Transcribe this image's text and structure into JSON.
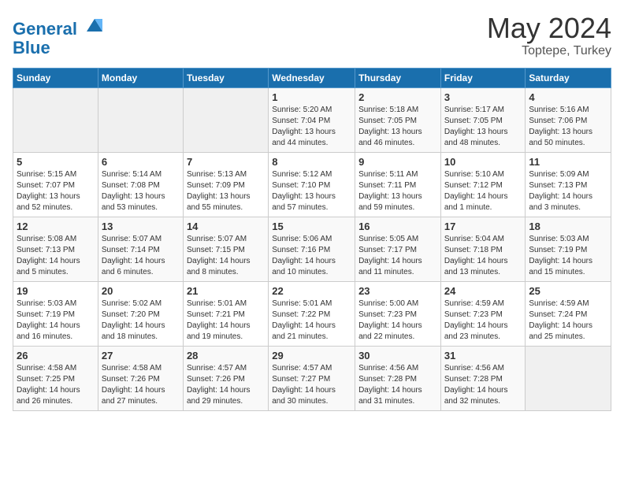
{
  "logo": {
    "line1": "General",
    "line2": "Blue"
  },
  "title": "May 2024",
  "location": "Toptepe, Turkey",
  "days_header": [
    "Sunday",
    "Monday",
    "Tuesday",
    "Wednesday",
    "Thursday",
    "Friday",
    "Saturday"
  ],
  "weeks": [
    [
      {
        "day": "",
        "info": ""
      },
      {
        "day": "",
        "info": ""
      },
      {
        "day": "",
        "info": ""
      },
      {
        "day": "1",
        "info": "Sunrise: 5:20 AM\nSunset: 7:04 PM\nDaylight: 13 hours\nand 44 minutes."
      },
      {
        "day": "2",
        "info": "Sunrise: 5:18 AM\nSunset: 7:05 PM\nDaylight: 13 hours\nand 46 minutes."
      },
      {
        "day": "3",
        "info": "Sunrise: 5:17 AM\nSunset: 7:05 PM\nDaylight: 13 hours\nand 48 minutes."
      },
      {
        "day": "4",
        "info": "Sunrise: 5:16 AM\nSunset: 7:06 PM\nDaylight: 13 hours\nand 50 minutes."
      }
    ],
    [
      {
        "day": "5",
        "info": "Sunrise: 5:15 AM\nSunset: 7:07 PM\nDaylight: 13 hours\nand 52 minutes."
      },
      {
        "day": "6",
        "info": "Sunrise: 5:14 AM\nSunset: 7:08 PM\nDaylight: 13 hours\nand 53 minutes."
      },
      {
        "day": "7",
        "info": "Sunrise: 5:13 AM\nSunset: 7:09 PM\nDaylight: 13 hours\nand 55 minutes."
      },
      {
        "day": "8",
        "info": "Sunrise: 5:12 AM\nSunset: 7:10 PM\nDaylight: 13 hours\nand 57 minutes."
      },
      {
        "day": "9",
        "info": "Sunrise: 5:11 AM\nSunset: 7:11 PM\nDaylight: 13 hours\nand 59 minutes."
      },
      {
        "day": "10",
        "info": "Sunrise: 5:10 AM\nSunset: 7:12 PM\nDaylight: 14 hours\nand 1 minute."
      },
      {
        "day": "11",
        "info": "Sunrise: 5:09 AM\nSunset: 7:13 PM\nDaylight: 14 hours\nand 3 minutes."
      }
    ],
    [
      {
        "day": "12",
        "info": "Sunrise: 5:08 AM\nSunset: 7:13 PM\nDaylight: 14 hours\nand 5 minutes."
      },
      {
        "day": "13",
        "info": "Sunrise: 5:07 AM\nSunset: 7:14 PM\nDaylight: 14 hours\nand 6 minutes."
      },
      {
        "day": "14",
        "info": "Sunrise: 5:07 AM\nSunset: 7:15 PM\nDaylight: 14 hours\nand 8 minutes."
      },
      {
        "day": "15",
        "info": "Sunrise: 5:06 AM\nSunset: 7:16 PM\nDaylight: 14 hours\nand 10 minutes."
      },
      {
        "day": "16",
        "info": "Sunrise: 5:05 AM\nSunset: 7:17 PM\nDaylight: 14 hours\nand 11 minutes."
      },
      {
        "day": "17",
        "info": "Sunrise: 5:04 AM\nSunset: 7:18 PM\nDaylight: 14 hours\nand 13 minutes."
      },
      {
        "day": "18",
        "info": "Sunrise: 5:03 AM\nSunset: 7:19 PM\nDaylight: 14 hours\nand 15 minutes."
      }
    ],
    [
      {
        "day": "19",
        "info": "Sunrise: 5:03 AM\nSunset: 7:19 PM\nDaylight: 14 hours\nand 16 minutes."
      },
      {
        "day": "20",
        "info": "Sunrise: 5:02 AM\nSunset: 7:20 PM\nDaylight: 14 hours\nand 18 minutes."
      },
      {
        "day": "21",
        "info": "Sunrise: 5:01 AM\nSunset: 7:21 PM\nDaylight: 14 hours\nand 19 minutes."
      },
      {
        "day": "22",
        "info": "Sunrise: 5:01 AM\nSunset: 7:22 PM\nDaylight: 14 hours\nand 21 minutes."
      },
      {
        "day": "23",
        "info": "Sunrise: 5:00 AM\nSunset: 7:23 PM\nDaylight: 14 hours\nand 22 minutes."
      },
      {
        "day": "24",
        "info": "Sunrise: 4:59 AM\nSunset: 7:23 PM\nDaylight: 14 hours\nand 23 minutes."
      },
      {
        "day": "25",
        "info": "Sunrise: 4:59 AM\nSunset: 7:24 PM\nDaylight: 14 hours\nand 25 minutes."
      }
    ],
    [
      {
        "day": "26",
        "info": "Sunrise: 4:58 AM\nSunset: 7:25 PM\nDaylight: 14 hours\nand 26 minutes."
      },
      {
        "day": "27",
        "info": "Sunrise: 4:58 AM\nSunset: 7:26 PM\nDaylight: 14 hours\nand 27 minutes."
      },
      {
        "day": "28",
        "info": "Sunrise: 4:57 AM\nSunset: 7:26 PM\nDaylight: 14 hours\nand 29 minutes."
      },
      {
        "day": "29",
        "info": "Sunrise: 4:57 AM\nSunset: 7:27 PM\nDaylight: 14 hours\nand 30 minutes."
      },
      {
        "day": "30",
        "info": "Sunrise: 4:56 AM\nSunset: 7:28 PM\nDaylight: 14 hours\nand 31 minutes."
      },
      {
        "day": "31",
        "info": "Sunrise: 4:56 AM\nSunset: 7:28 PM\nDaylight: 14 hours\nand 32 minutes."
      },
      {
        "day": "",
        "info": ""
      }
    ]
  ]
}
